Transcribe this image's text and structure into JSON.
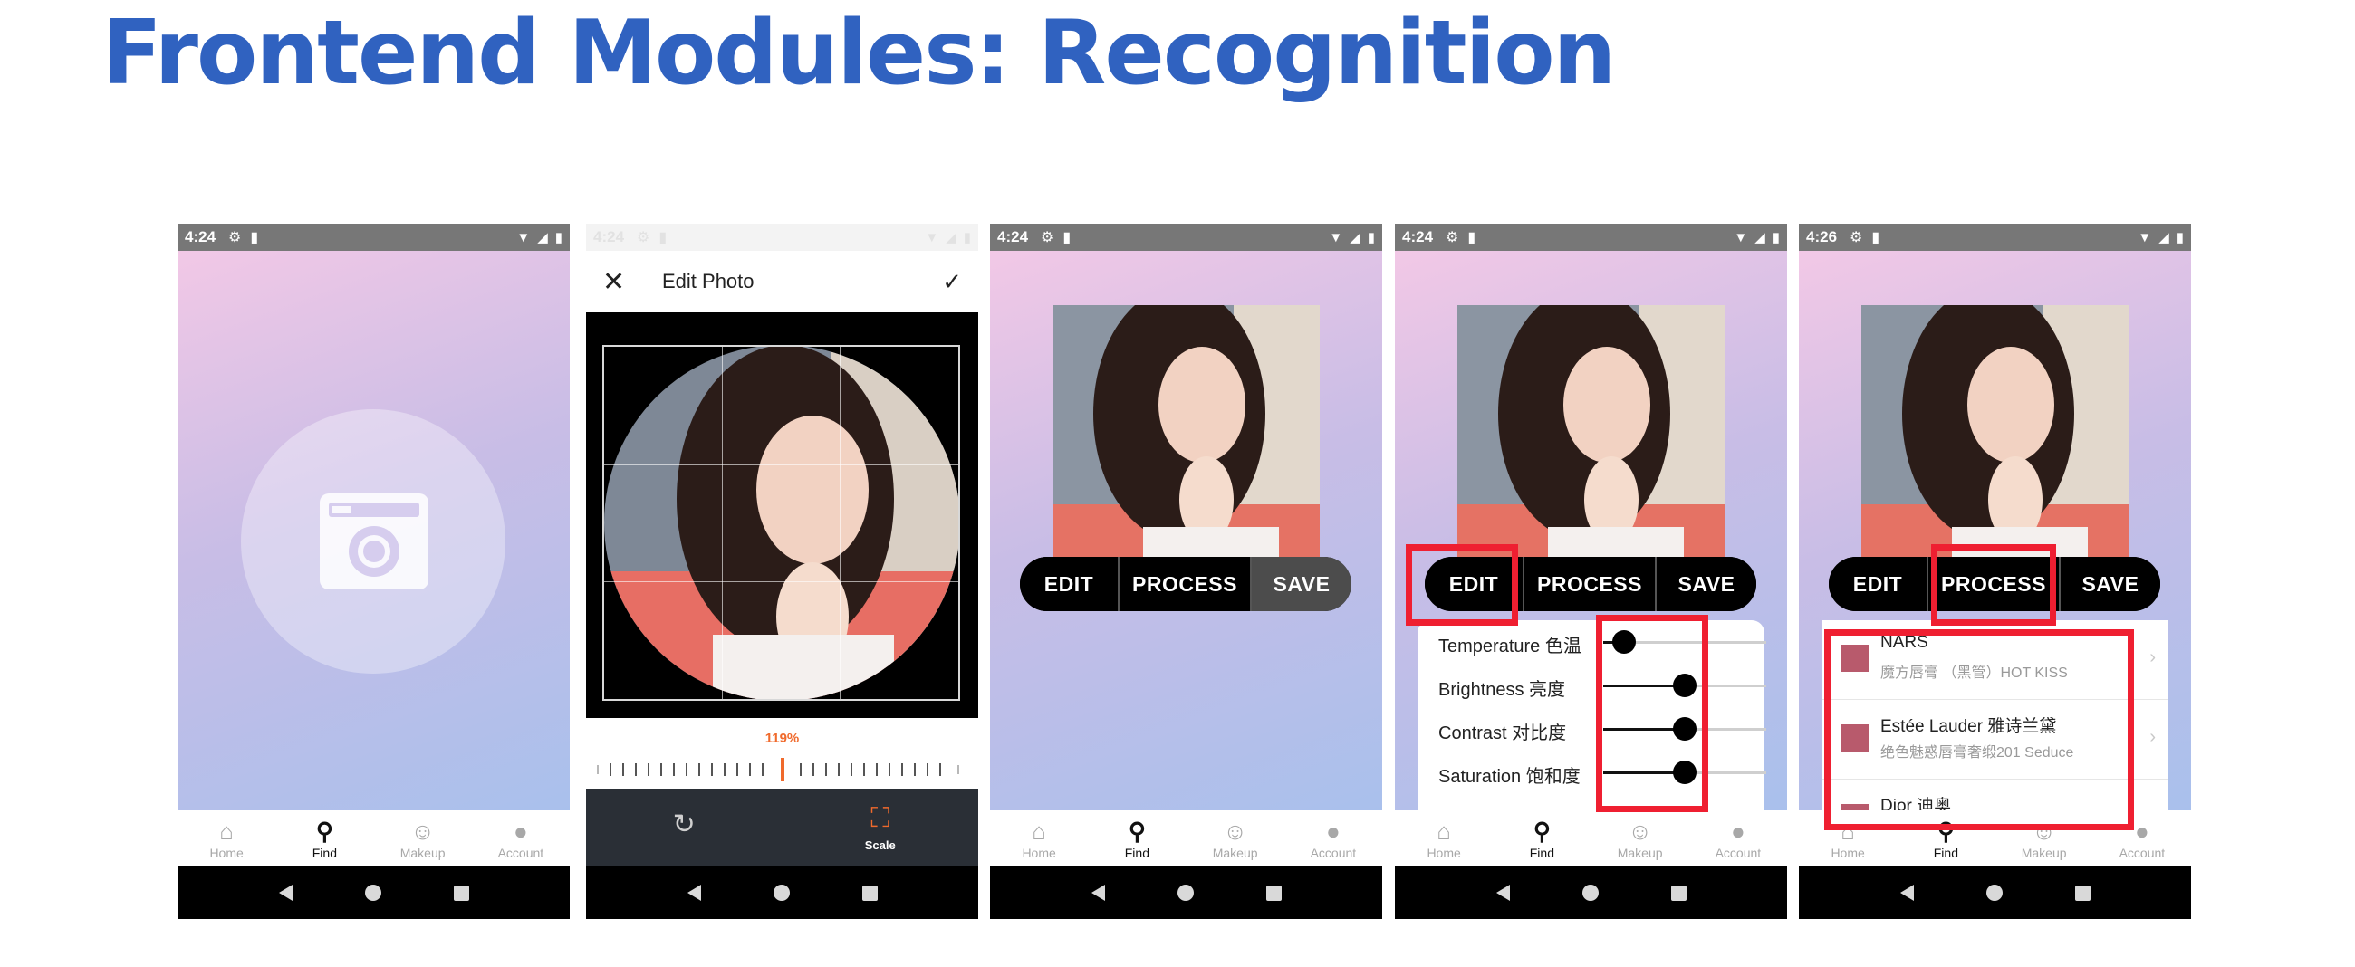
{
  "slide": {
    "title": "Frontend Modules: Recognition"
  },
  "common": {
    "tabs": [
      {
        "label": "Home",
        "icon": "home-icon",
        "glyph": "⌂"
      },
      {
        "label": "Find",
        "icon": "search-icon",
        "glyph": "⚲"
      },
      {
        "label": "Makeup",
        "icon": "smiley-icon",
        "glyph": "☺"
      },
      {
        "label": "Account",
        "icon": "account-icon",
        "glyph": "●"
      }
    ],
    "active_tab": "Find",
    "accent_color": "#3062c0",
    "highlight_color": "#ef1f31"
  },
  "screens": [
    {
      "time": "4:24"
    },
    {
      "time": "4:24",
      "header_title": "Edit Photo",
      "scale_value": "119%",
      "tools": [
        {
          "label": "",
          "icon": "rotate-icon"
        },
        {
          "label": "Scale",
          "icon": "crop-scale-icon"
        }
      ]
    },
    {
      "time": "4:24",
      "buttons": [
        "EDIT",
        "PROCESS",
        "SAVE"
      ]
    },
    {
      "time": "4:24",
      "buttons": [
        "EDIT",
        "PROCESS",
        "SAVE"
      ],
      "sliders": [
        {
          "label": "Temperature 色温",
          "value": 0.13
        },
        {
          "label": "Brightness 亮度",
          "value": 0.5
        },
        {
          "label": "Contrast 对比度",
          "value": 0.5
        },
        {
          "label": "Saturation 饱和度",
          "value": 0.5
        }
      ]
    },
    {
      "time": "4:26",
      "buttons": [
        "EDIT",
        "PROCESS",
        "SAVE"
      ],
      "products": [
        {
          "brand": "NARS",
          "shade": "魔方唇膏 （黑管）HOT KISS",
          "color": "#b85a6c"
        },
        {
          "brand": "Estée Lauder 雅诗兰黛",
          "shade": "绝色魅惑唇膏奢缎201 Seduce",
          "color": "#b85a6c"
        },
        {
          "brand": "Dior 迪奥",
          "shade": "",
          "color": "#b85a6c"
        }
      ]
    }
  ]
}
